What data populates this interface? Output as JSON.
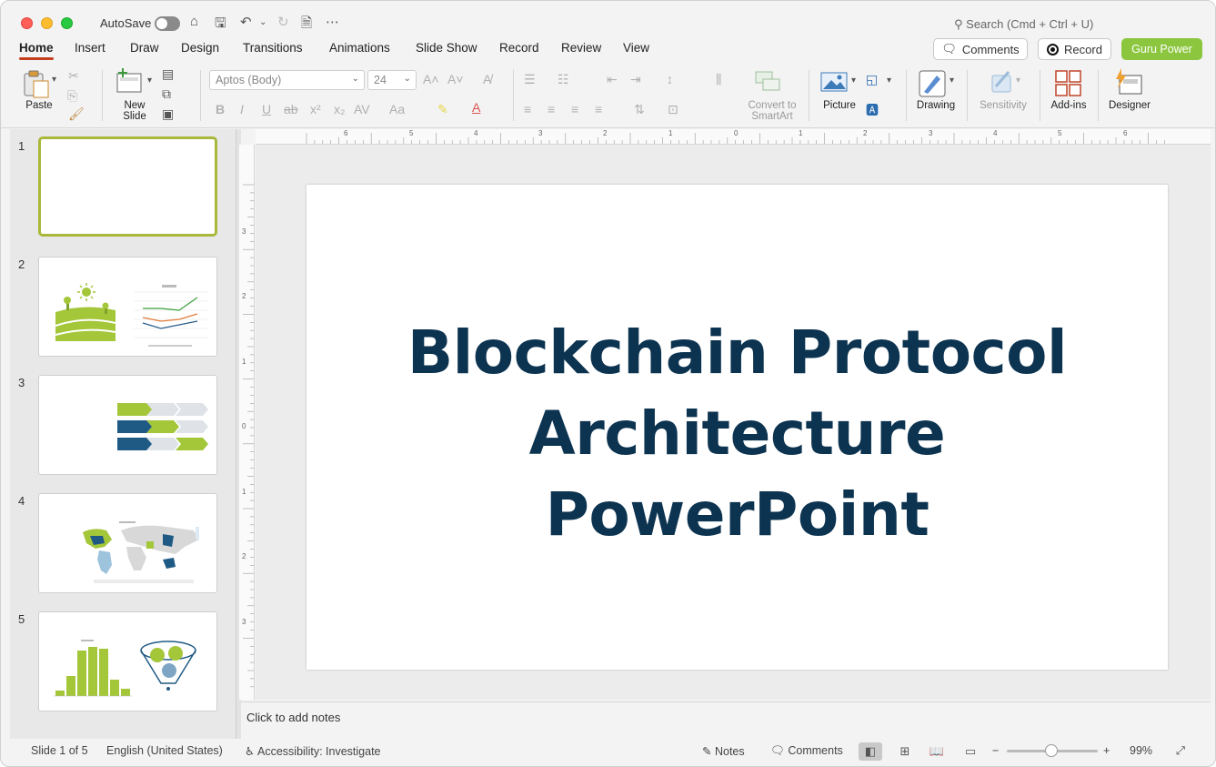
{
  "titlebar": {
    "autosave_label": "AutoSave",
    "search_placeholder": "Search (Cmd + Ctrl + U)"
  },
  "tabs": [
    "Home",
    "Insert",
    "Draw",
    "Design",
    "Transitions",
    "Animations",
    "Slide Show",
    "Record",
    "Review",
    "View"
  ],
  "header_buttons": {
    "comments": "Comments",
    "record": "Record",
    "guru": "Guru Power"
  },
  "ribbon": {
    "paste": "Paste",
    "new_slide": "New Slide",
    "font_name": "Aptos (Body)",
    "font_size": "24",
    "convert_smartart": "Convert to SmartArt",
    "picture": "Picture",
    "drawing": "Drawing",
    "sensitivity": "Sensitivity",
    "addins": "Add-ins",
    "designer": "Designer"
  },
  "slides": [
    {
      "num": "1",
      "selected": true
    },
    {
      "num": "2"
    },
    {
      "num": "3"
    },
    {
      "num": "4"
    },
    {
      "num": "5"
    }
  ],
  "ruler": {
    "h": [
      "6",
      "5",
      "4",
      "3",
      "2",
      "1",
      "0",
      "1",
      "2",
      "3",
      "4",
      "5",
      "6"
    ],
    "v": [
      "3",
      "2",
      "1",
      "0",
      "1",
      "2",
      "3"
    ]
  },
  "slide": {
    "title_line1": "Blockchain Protocol",
    "title_line2": "Architecture",
    "title_line3": "PowerPoint"
  },
  "notes_placeholder": "Click to add notes",
  "status": {
    "slide_count": "Slide 1 of 5",
    "language": "English (United States)",
    "accessibility": "Accessibility: Investigate",
    "notes": "Notes",
    "comments": "Comments",
    "zoom": "99%"
  },
  "colors": {
    "accent_tab": "#c43e1c",
    "guru": "#8cc63f",
    "title": "#0c3350",
    "thumb_green": "#a4c639",
    "thumb_blue": "#1f5a85"
  }
}
